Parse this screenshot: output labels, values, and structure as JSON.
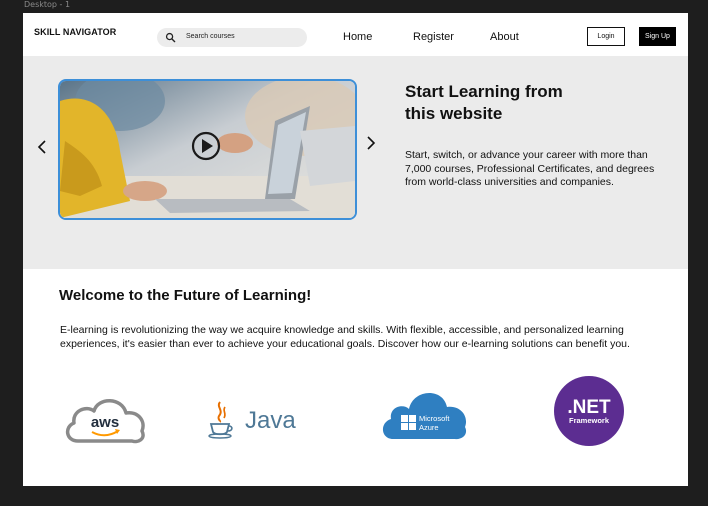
{
  "frame": {
    "label": "Desktop - 1"
  },
  "header": {
    "brand": "SKILL NAVIGATOR",
    "search_placeholder": "Search courses",
    "nav": {
      "home": "Home",
      "register": "Register",
      "about": "About"
    },
    "login_label": "Login",
    "signup_label": "Sign Up"
  },
  "hero": {
    "title_line1": "Start Learning from",
    "title_line2": "this website",
    "description": "Start, switch, or advance your career with more than 7,000 courses, Professional Certificates, and degrees from world-class universities and companies."
  },
  "welcome": {
    "title": "Welcome to the Future of Learning!",
    "text": "E-learning is revolutionizing the way we acquire knowledge and skills. With flexible, accessible, and personalized learning experiences, it's easier than ever to achieve your educational goals. Discover how our e-learning solutions can benefit you."
  },
  "logos": {
    "aws": "aws",
    "java": "Java",
    "azure_line1": "Microsoft",
    "azure_line2": "Azure",
    "net_line1": ".NET",
    "net_line2": "Framework"
  },
  "colors": {
    "accent_border": "#3d8fd8",
    "hero_bg": "#ebebeb",
    "azure_blue": "#2f7fc1",
    "net_purple": "#5c2d91",
    "aws_orange": "#f90"
  }
}
